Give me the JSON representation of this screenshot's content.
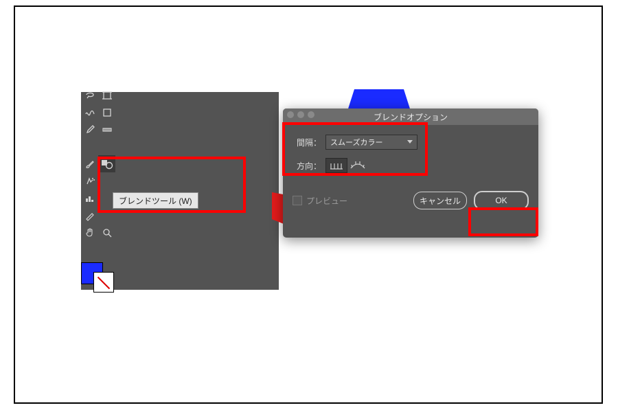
{
  "tooltip": {
    "text": "ブレンドツール (W)"
  },
  "dialog": {
    "title": "ブレンドオプション",
    "spacing_label": "間隔：",
    "spacing_value": "スムーズカラー",
    "orientation_label": "方向：",
    "preview_label": "プレビュー",
    "cancel_label": "キャンセル",
    "ok_label": "OK"
  },
  "colors": {
    "highlight": "#ff0000",
    "panel": "#535353",
    "swatch_fill": "#1a2bff"
  }
}
